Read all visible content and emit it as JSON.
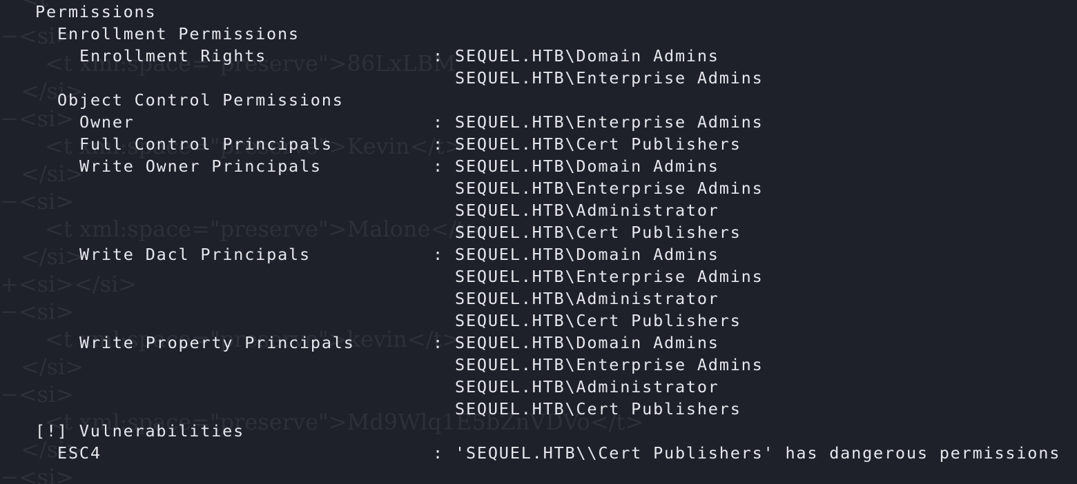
{
  "terminal": {
    "colors": {
      "background": "#1e2129",
      "foreground": "#e6e8ee",
      "ghost_text": "#3a3e48"
    },
    "separator": ":",
    "permissions_header": "Permissions",
    "enrollment_section": {
      "title": "Enrollment Permissions",
      "enrollment_rights": {
        "label": "Enrollment Rights",
        "values": [
          "SEQUEL.HTB\\Domain Admins",
          "SEQUEL.HTB\\Enterprise Admins"
        ]
      }
    },
    "object_control_section": {
      "title": "Object Control Permissions",
      "owner": {
        "label": "Owner",
        "values": [
          "SEQUEL.HTB\\Enterprise Admins"
        ]
      },
      "full_control": {
        "label": "Full Control Principals",
        "values": [
          "SEQUEL.HTB\\Cert Publishers"
        ]
      },
      "write_owner": {
        "label": "Write Owner Principals",
        "values": [
          "SEQUEL.HTB\\Domain Admins",
          "SEQUEL.HTB\\Enterprise Admins",
          "SEQUEL.HTB\\Administrator",
          "SEQUEL.HTB\\Cert Publishers"
        ]
      },
      "write_dacl": {
        "label": "Write Dacl Principals",
        "values": [
          "SEQUEL.HTB\\Domain Admins",
          "SEQUEL.HTB\\Enterprise Admins",
          "SEQUEL.HTB\\Administrator",
          "SEQUEL.HTB\\Cert Publishers"
        ]
      },
      "write_property": {
        "label": "Write Property Principals",
        "values": [
          "SEQUEL.HTB\\Domain Admins",
          "SEQUEL.HTB\\Enterprise Admins",
          "SEQUEL.HTB\\Administrator",
          "SEQUEL.HTB\\Cert Publishers"
        ]
      }
    },
    "vulnerabilities": {
      "title": "[!] Vulnerabilities",
      "esc4": {
        "label": "ESC4",
        "value": "'SEQUEL.HTB\\\\Cert Publishers' has dangerous permissions"
      }
    }
  },
  "background_ghost": {
    "lines": [
      "<t",
      "−<si>",
      "<t xml:space=\"preserve\">86LxLBM",
      "</si>",
      "−<si>",
      "<t xml:space=\"preserve\">Kevin</t>",
      "</si>",
      "−<si>",
      "<t xml:space=\"preserve\">Malone</t>",
      "</si>",
      "+<si></si>",
      "−<si>",
      "<t xml:space=\"preserve\">kevin</t>",
      "</si>",
      "−<si>",
      "<t xml:space=\"preserve\">Md9Wlq1E5bZnVDVo</t>",
      "</si>",
      "−<si>"
    ]
  }
}
